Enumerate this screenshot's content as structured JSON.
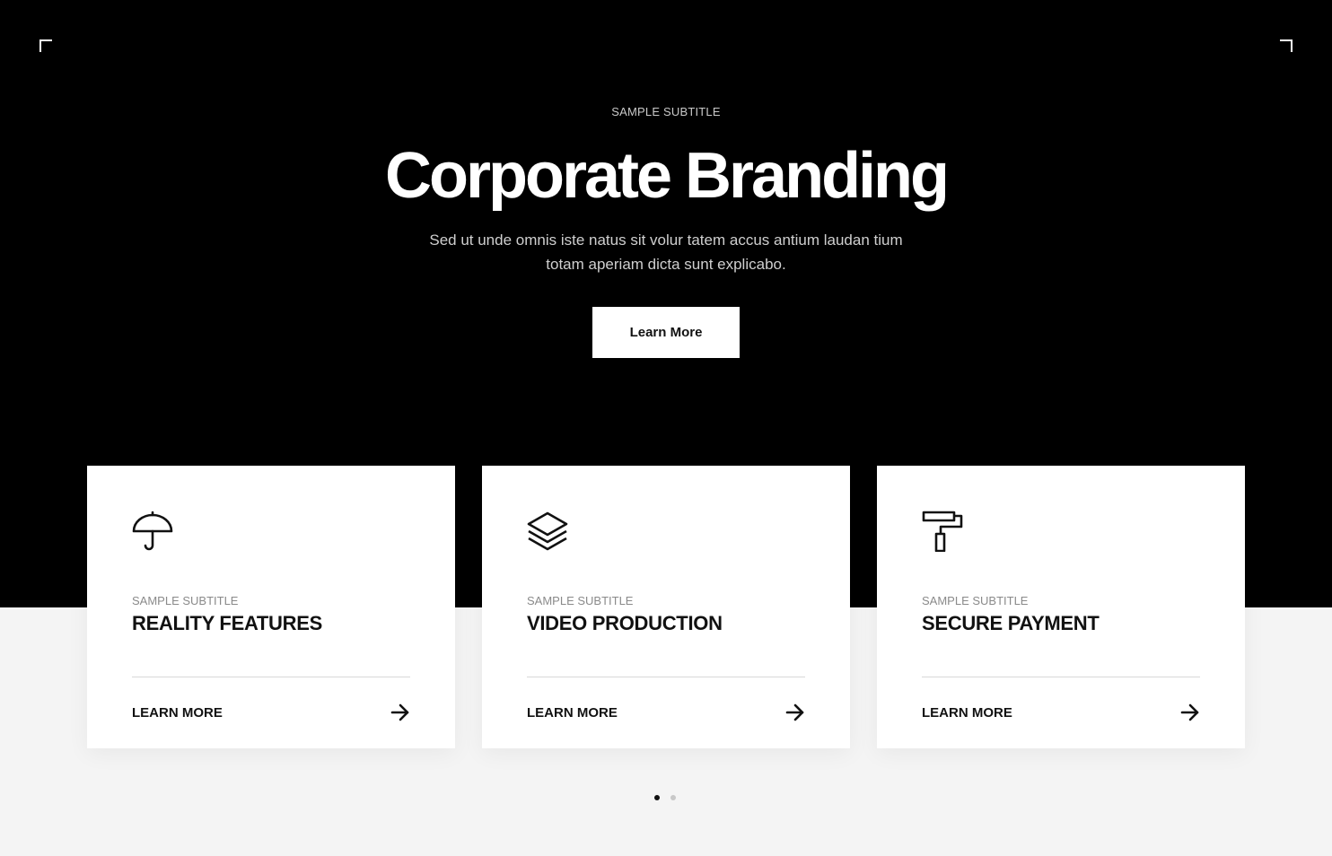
{
  "hero": {
    "subtitle": "SAMPLE SUBTITLE",
    "title": "Corporate Branding",
    "description": "Sed ut unde omnis iste natus sit volur tatem accus antium laudan tium totam aperiam dicta sunt explicabo.",
    "button_label": "Learn More"
  },
  "cards": [
    {
      "icon": "umbrella-icon",
      "subtitle": "SAMPLE SUBTITLE",
      "title": "REALITY FEATURES",
      "link_label": "LEARN MORE"
    },
    {
      "icon": "layers-icon",
      "subtitle": "SAMPLE SUBTITLE",
      "title": "VIDEO PRODUCTION",
      "link_label": "LEARN MORE"
    },
    {
      "icon": "paint-roller-icon",
      "subtitle": "SAMPLE SUBTITLE",
      "title": "SECURE PAYMENT",
      "link_label": "LEARN MORE"
    }
  ],
  "pagination": {
    "total": 2,
    "active": 1
  },
  "colors": {
    "hero_bg": "#000000",
    "page_bg": "#f4f4f4",
    "card_bg": "#ffffff",
    "text_dark": "#111111"
  }
}
